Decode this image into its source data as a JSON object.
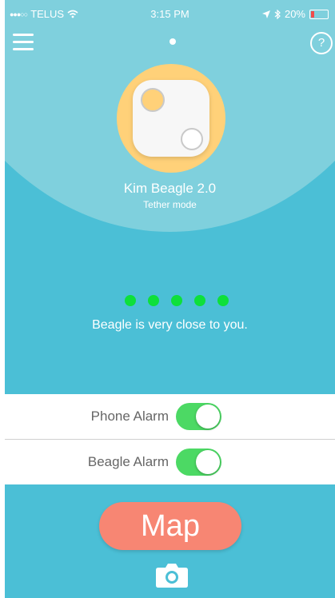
{
  "status_bar": {
    "signal": "●●●○○",
    "carrier": "TELUS",
    "time": "3:15 PM",
    "battery": "20%",
    "battery_level": 0.2
  },
  "header": {
    "help_label": "?"
  },
  "device": {
    "name": "Kim Beagle 2.0",
    "mode": "Tether mode"
  },
  "proximity": {
    "signal_dots": 5,
    "message": "Beagle is very close to you."
  },
  "alarms": [
    {
      "label": "Phone Alarm",
      "enabled": true
    },
    {
      "label": "Beagle Alarm",
      "enabled": true
    }
  ],
  "actions": {
    "map_label": "Map"
  },
  "colors": {
    "background": "#4bbfd6",
    "arc": "#7fd0dd",
    "device_ring": "#ffd179",
    "signal": "#0ee03a",
    "toggle_on": "#4cd964",
    "map_button": "#f78673"
  }
}
